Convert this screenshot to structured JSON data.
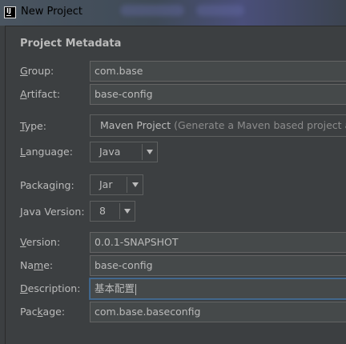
{
  "window": {
    "title": "New Project",
    "icon_text": "IJ"
  },
  "section": {
    "title": "Project Metadata"
  },
  "fields": {
    "group": {
      "label_mn": "G",
      "label_rest": "roup:",
      "value": "com.base"
    },
    "artifact": {
      "label_mn": "A",
      "label_rest": "rtifact:",
      "value": "base-config"
    },
    "type": {
      "label_mn": "T",
      "label_rest": "ype:",
      "value": "Maven Project",
      "hint": " (Generate a Maven based project archive)"
    },
    "language": {
      "label_mn": "L",
      "label_rest": "anguage:",
      "value": "Java"
    },
    "packaging": {
      "label_pre": "Packa",
      "label_mn": "g",
      "label_rest": "ing:",
      "value": "Jar"
    },
    "java_version": {
      "label_mn": "J",
      "label_rest": "ava Version:",
      "value": "8"
    },
    "version": {
      "label_mn": "V",
      "label_rest": "ersion:",
      "value": "0.0.1-SNAPSHOT"
    },
    "name": {
      "label_pre": "Na",
      "label_mn": "m",
      "label_rest": "e:",
      "value": "base-config"
    },
    "description": {
      "label_mn": "D",
      "label_rest": "escription:",
      "value": "基本配置"
    },
    "package": {
      "label_pre": "Pac",
      "label_mn": "k",
      "label_rest": "age:",
      "value": "com.base.baseconfig"
    }
  },
  "colors": {
    "background": "#3c3f41",
    "field_bg": "#45494a",
    "focus": "#466d94",
    "text": "#bbbbbb"
  }
}
